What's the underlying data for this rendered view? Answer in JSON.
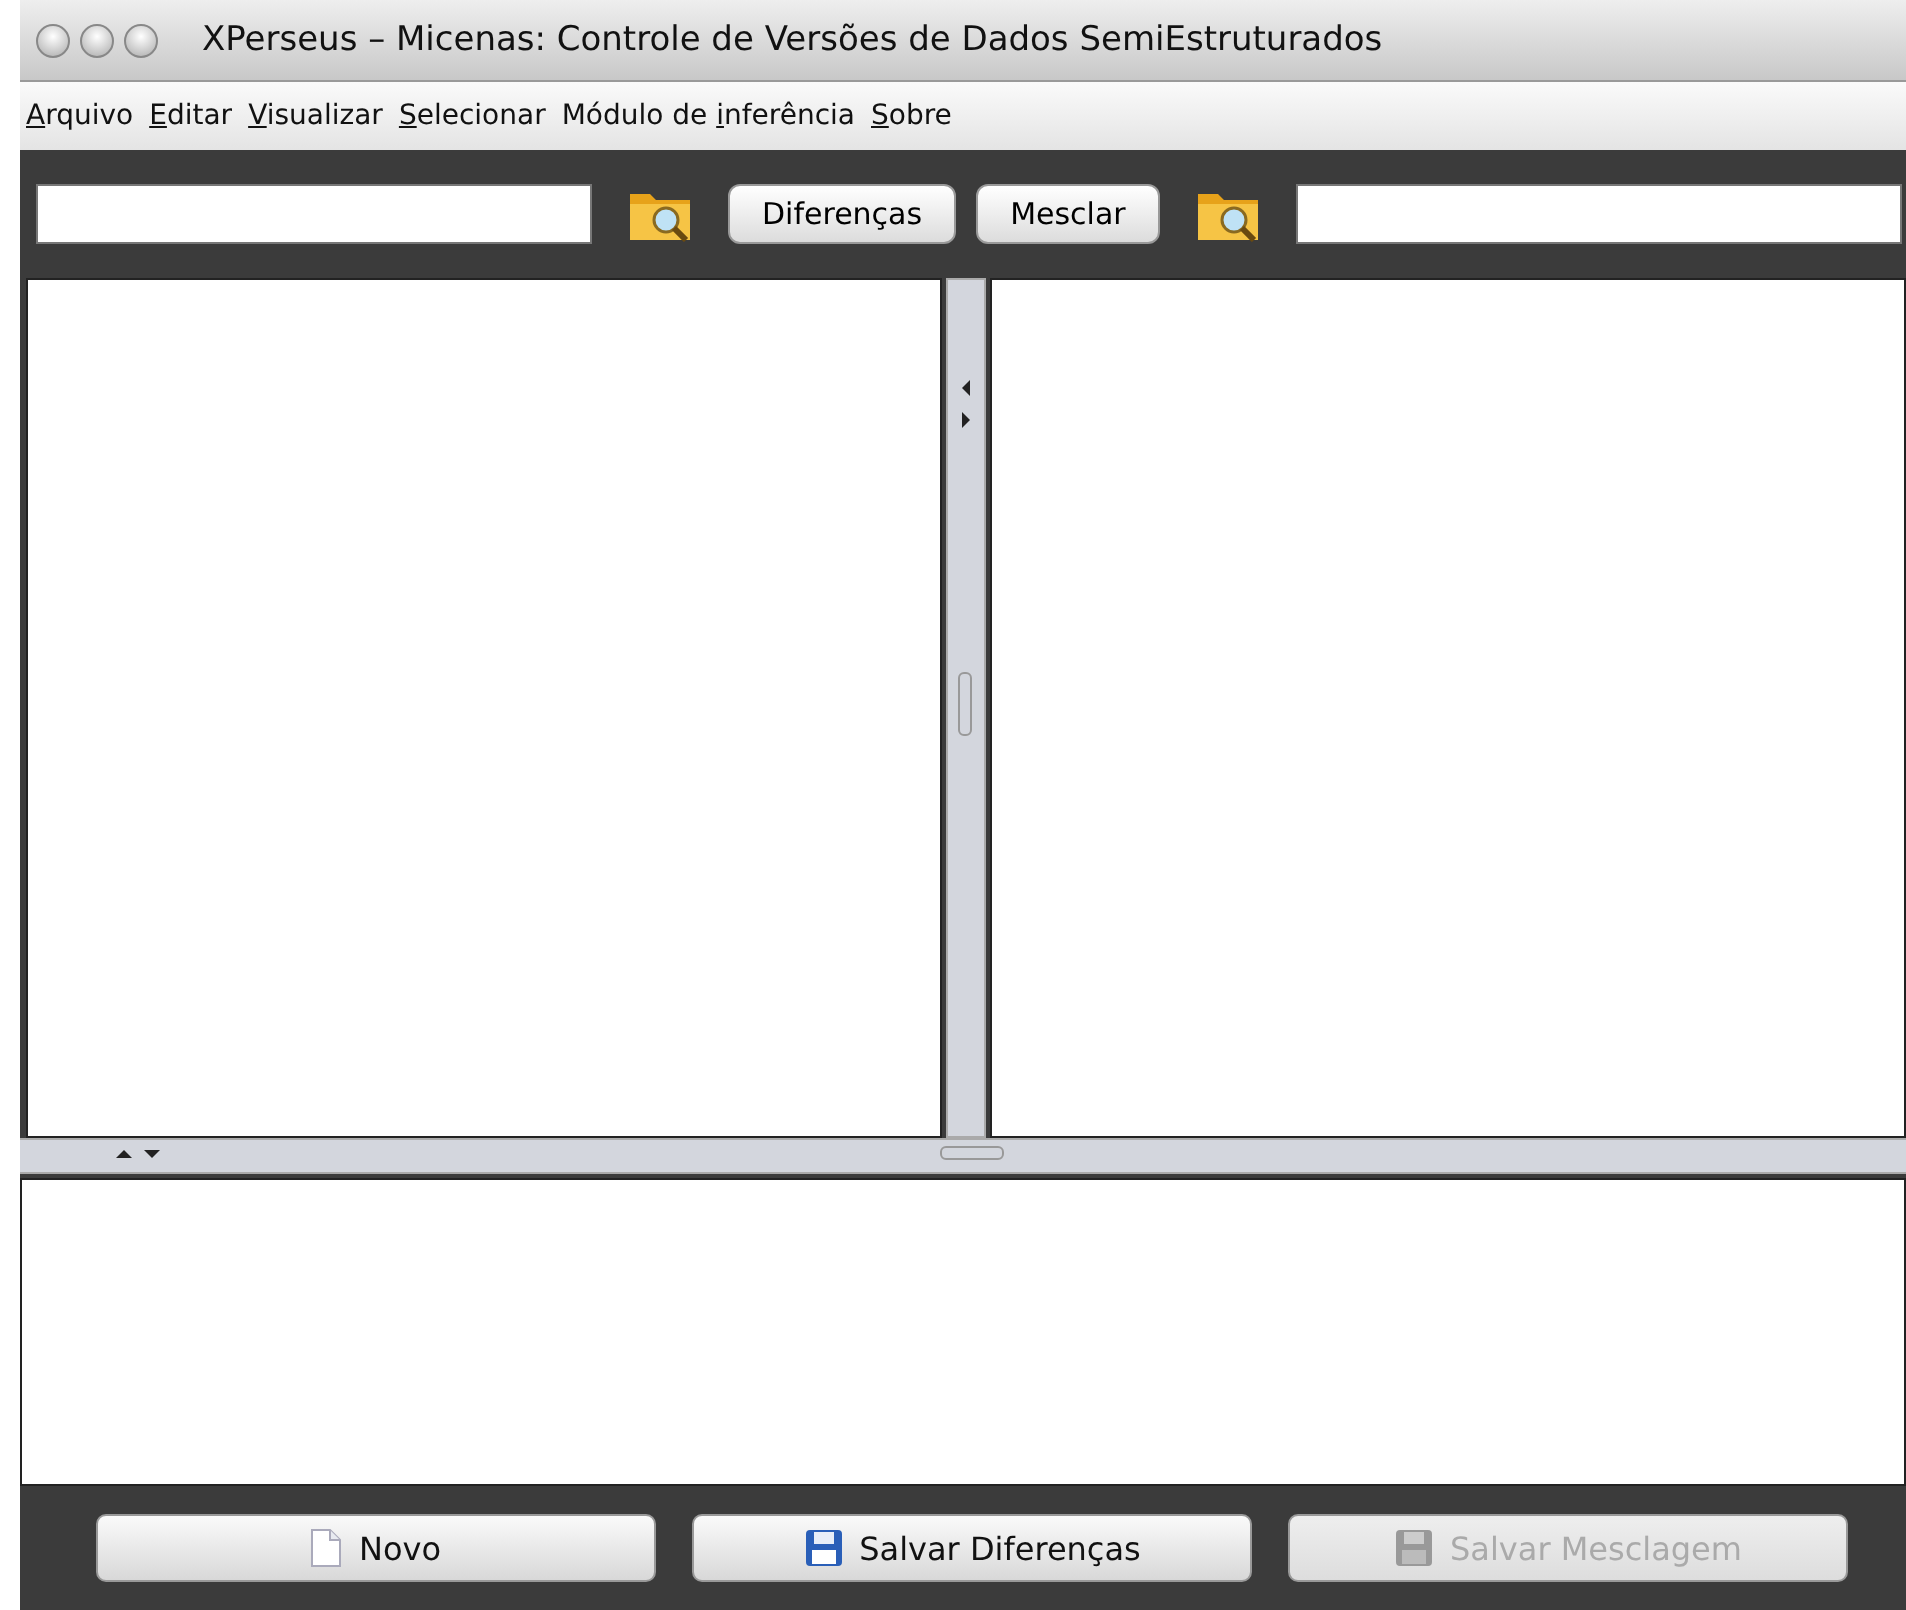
{
  "window": {
    "title": "XPerseus – Micenas: Controle de Versões de Dados SemiEstruturados"
  },
  "menu": [
    {
      "key": "A",
      "after": "rquivo"
    },
    {
      "key": "E",
      "after": "ditar"
    },
    {
      "key": "V",
      "after": "isualizar"
    },
    {
      "key": "S",
      "after": "elecionar"
    },
    {
      "before": "Módulo de ",
      "key": "i",
      "after": "nferência"
    },
    {
      "key": "S",
      "after": "obre"
    }
  ],
  "toolbar": {
    "diff_button": "Diferenças",
    "merge_button": "Mesclar"
  },
  "buttons": [
    {
      "label": "Novo",
      "kind": "document",
      "disabled": false
    },
    {
      "label": "Salvar Diferenças",
      "kind": "save",
      "disabled": false
    },
    {
      "label": "Salvar Mesclagem",
      "kind": "save",
      "disabled": true
    }
  ]
}
